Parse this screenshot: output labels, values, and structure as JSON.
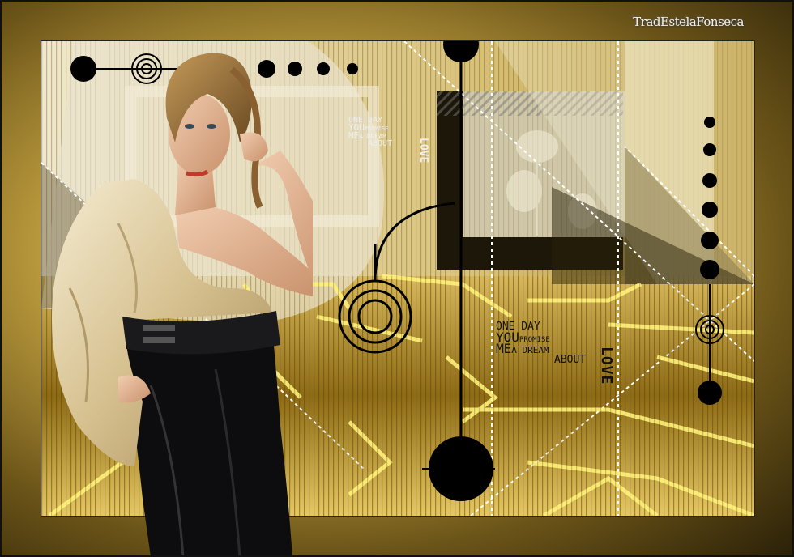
{
  "watermark": "TradEstelaFonseca",
  "poster_text_1": {
    "line1": "ONE DAY",
    "line2a": "YOU",
    "line2b": "PROMISE",
    "line3a": "ME",
    "line3b": "A DREAM",
    "line4": "ABOUT",
    "love": "LOVE"
  },
  "poster_text_2": {
    "line1": "ONE DAY",
    "line2a": "YOU",
    "line2b": "PROMISE",
    "line3a": "ME",
    "line3b": "A DREAM",
    "line4": "ABOUT",
    "love": "LOVE"
  },
  "colors": {
    "gold": "#c9a744",
    "dark": "#111111",
    "neon": "#fff27a",
    "cream": "#efe6c8"
  }
}
